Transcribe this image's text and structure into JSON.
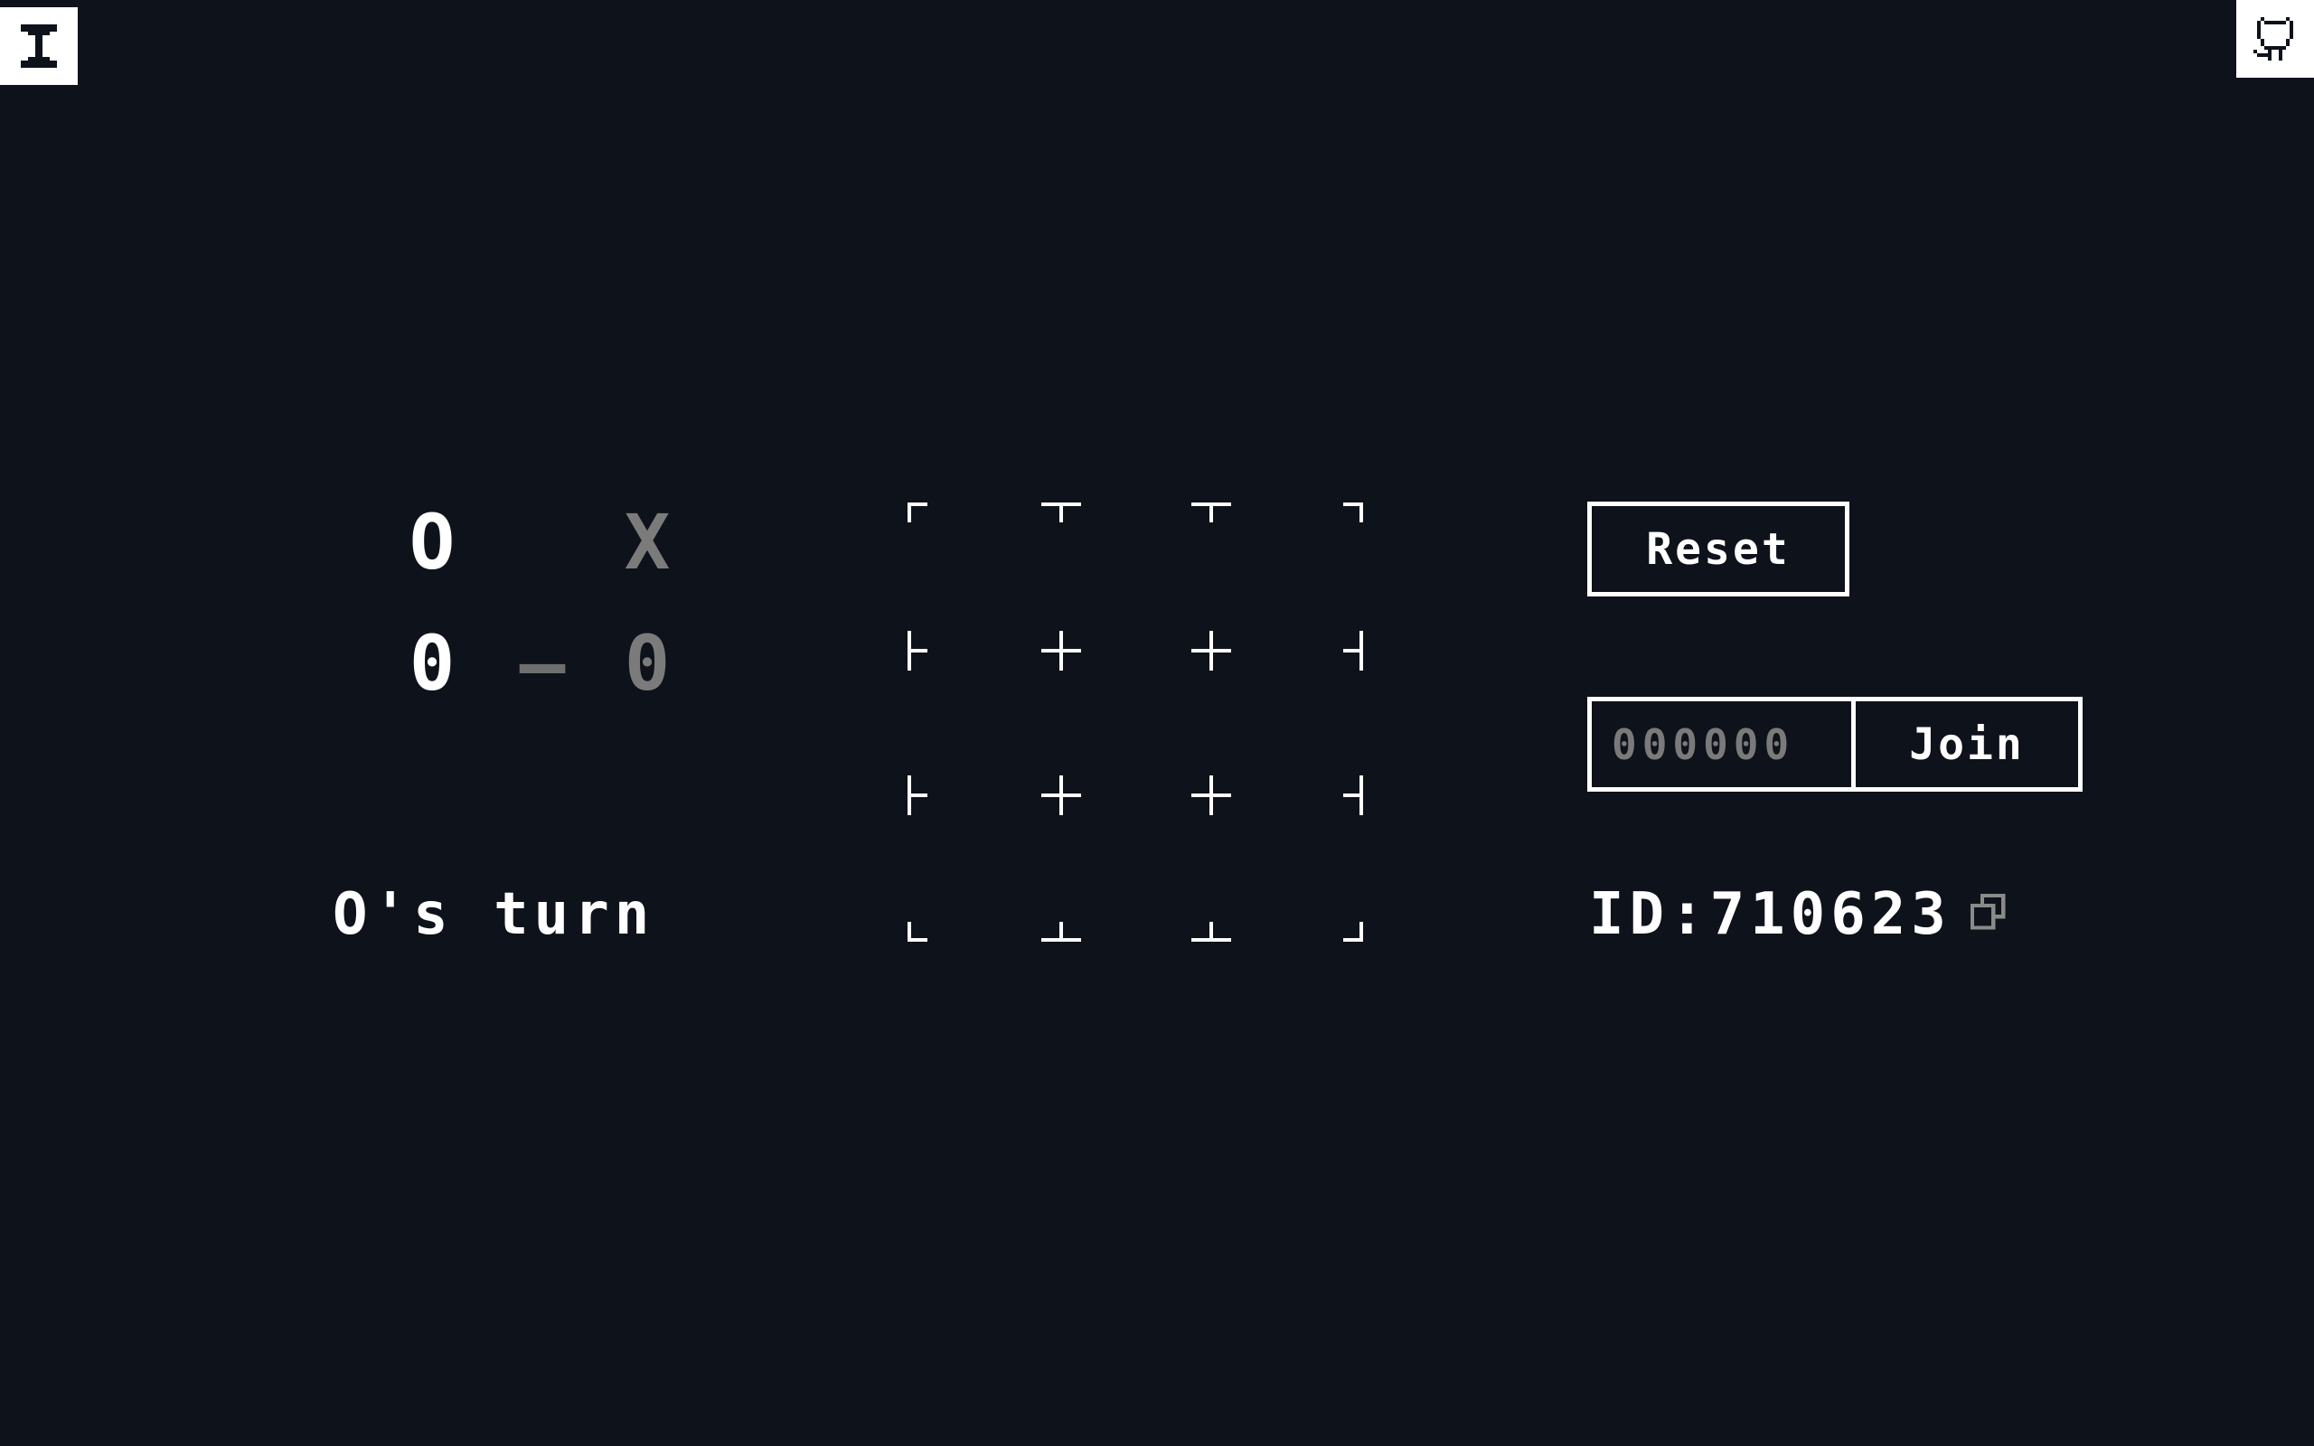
{
  "header": {
    "left_icon": "text-cursor-icon",
    "right_icon": "github-cat-icon"
  },
  "scoreboard": {
    "player_o_mark": "O",
    "player_x_mark": "X",
    "score_o": "0",
    "separator": "—",
    "score_x": "0"
  },
  "status": {
    "turn_text": "O's turn"
  },
  "board": {
    "cells": [
      "",
      "",
      "",
      "",
      "",
      "",
      "",
      "",
      ""
    ]
  },
  "controls": {
    "reset_label": "Reset",
    "join_placeholder": "000000",
    "join_value": "",
    "join_label": "Join",
    "game_id_label": "ID:",
    "game_id_value": "710623",
    "copy_icon": "copy-icon"
  },
  "colors": {
    "background": "#0e121a",
    "foreground": "#ffffff",
    "muted": "#7b7b7b"
  }
}
